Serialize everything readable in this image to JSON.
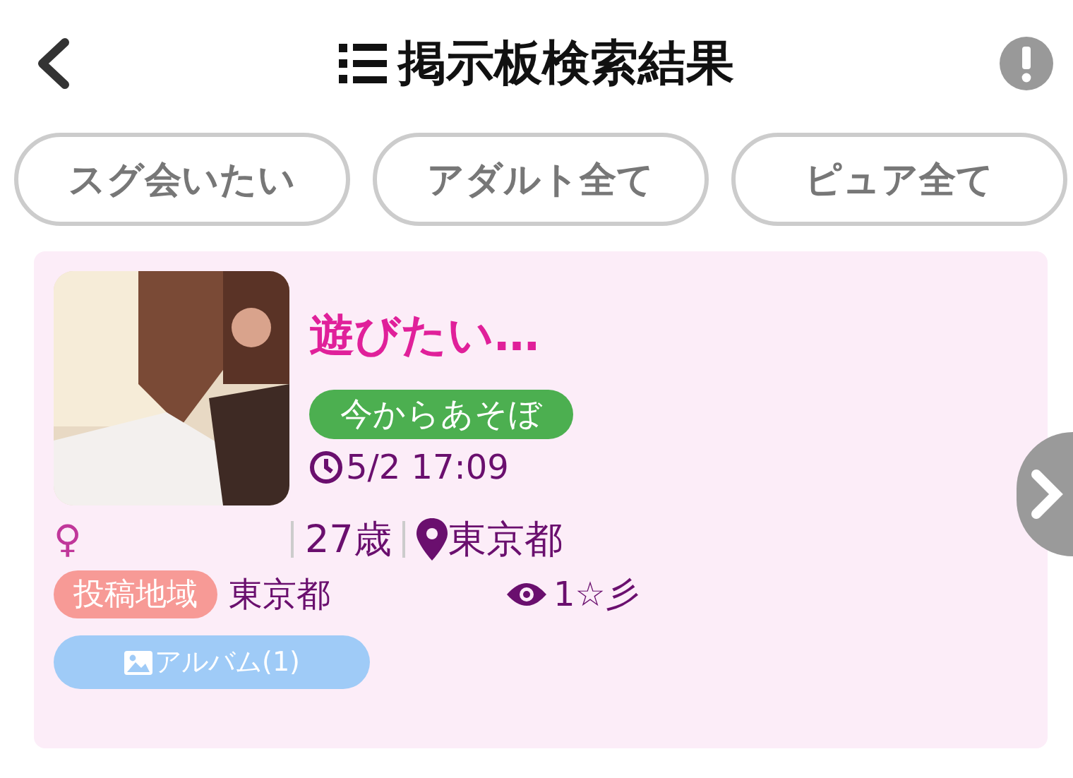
{
  "header": {
    "title": "掲示板検索結果"
  },
  "filters": [
    {
      "label": "スグ会いたい"
    },
    {
      "label": "アダルト全て"
    },
    {
      "label": "ピュア全て"
    }
  ],
  "post": {
    "title": "遊びたい…",
    "tag": "今からあそぼ",
    "time": "5/2 17:09",
    "gender": "♀",
    "age": "27歳",
    "location": "東京都",
    "region_label": "投稿地域",
    "region": "東京都",
    "views": "1☆彡",
    "album": "アルバム(1)"
  }
}
